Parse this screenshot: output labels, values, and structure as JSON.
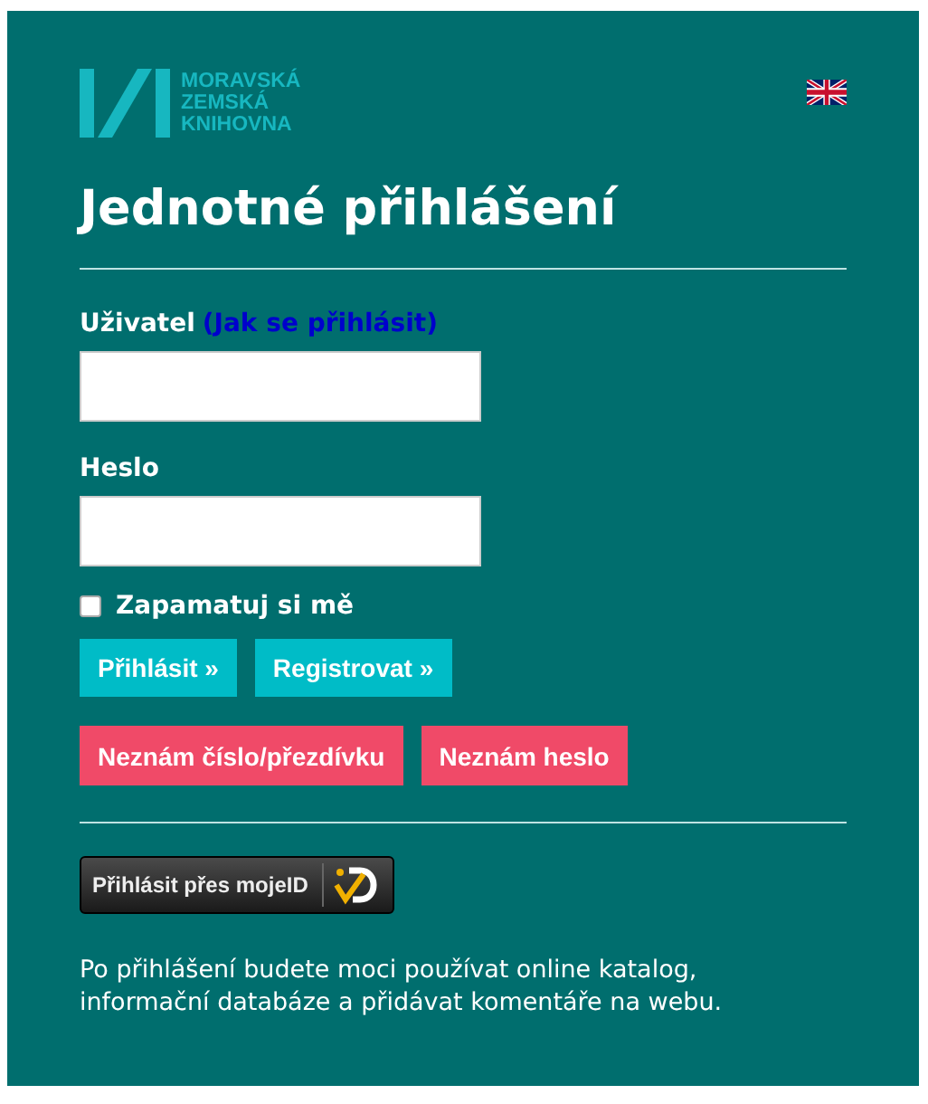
{
  "logo": {
    "lines": [
      "MORAVSKÁ",
      "ZEMSKÁ",
      "KNIHOVNA"
    ]
  },
  "language_flag": {
    "kind": "uk"
  },
  "title": "Jednotné přihlášení",
  "fields": [
    {
      "label": "Uživatel",
      "help_link": "(Jak se přihlásit)"
    },
    {
      "label": "Heslo"
    }
  ],
  "remember": {
    "label": "Zapamatuj si mě",
    "checked": false
  },
  "primary_buttons": [
    "Přihlásit »",
    "Registrovat »"
  ],
  "recovery_buttons": [
    "Neznám číslo/přezdívku",
    "Neznám heslo"
  ],
  "mojeid_button": "Přihlásit přes mojeID",
  "note_lines": [
    "Po přihlášení budete moci používat online katalog,",
    "informační databáze a přidávat komentáře na webu."
  ]
}
